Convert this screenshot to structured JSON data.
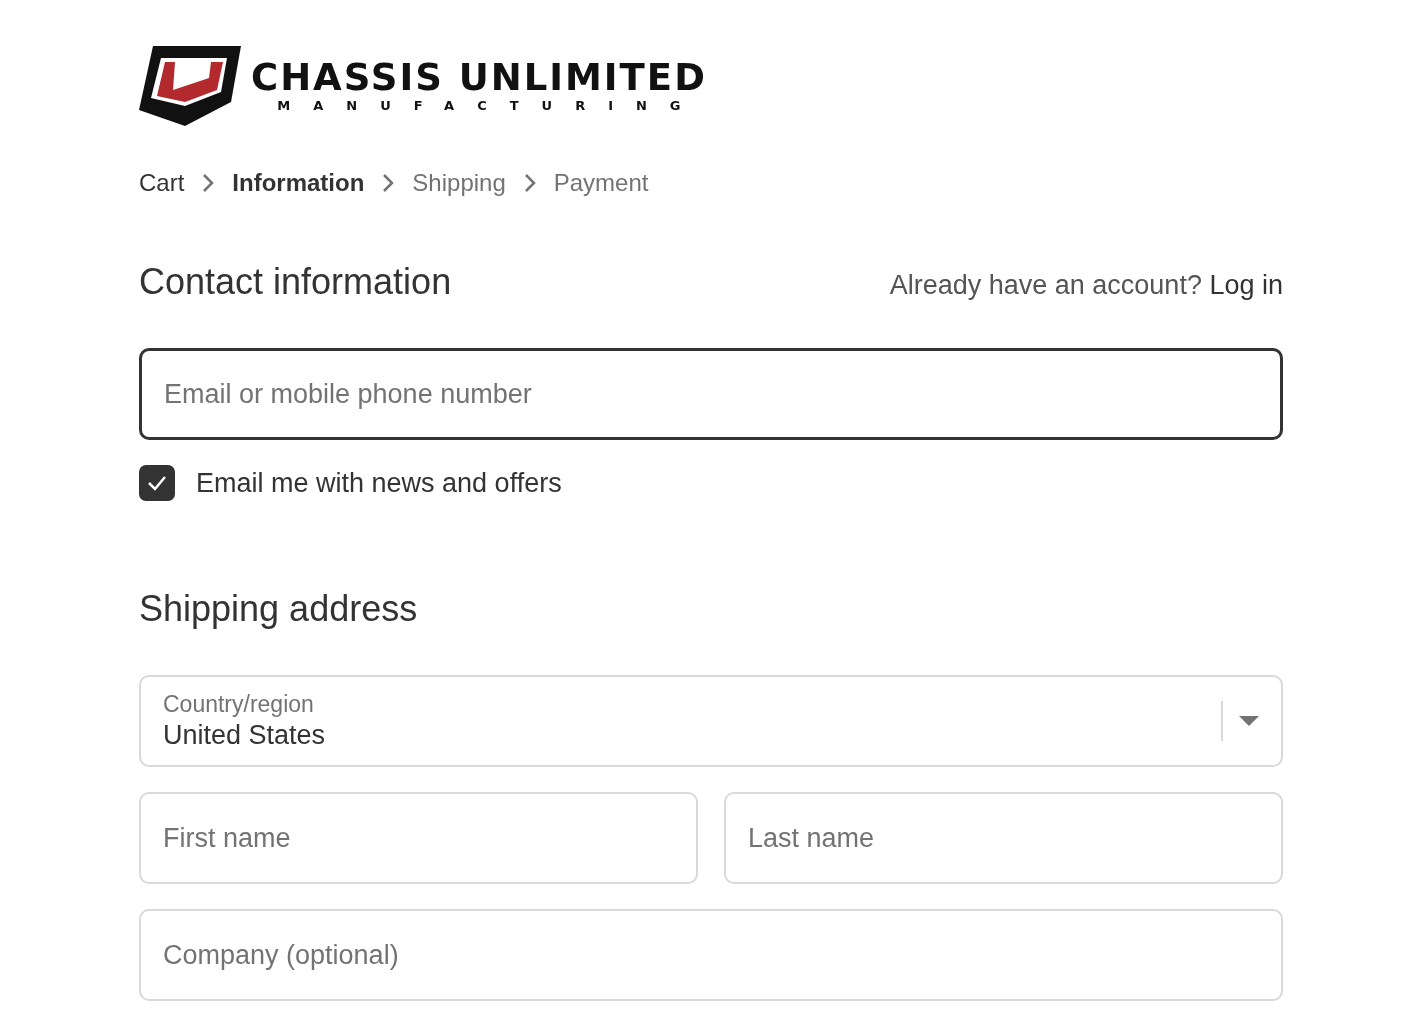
{
  "logo": {
    "name": "CHASSIS UNLIMITED",
    "tagline": "MANUFACTURING"
  },
  "breadcrumbs": [
    {
      "label": "Cart",
      "selected": false,
      "completed": true
    },
    {
      "label": "Information",
      "selected": true,
      "completed": false
    },
    {
      "label": "Shipping",
      "selected": false,
      "completed": false
    },
    {
      "label": "Payment",
      "selected": false,
      "completed": false
    }
  ],
  "contact": {
    "title": "Contact information",
    "login_prompt": "Already have an account?",
    "login_link": "Log in",
    "email_placeholder": "Email or mobile phone number",
    "email_focused": true,
    "newsletter": {
      "label": "Email me with news and offers",
      "checked": true
    }
  },
  "shipping": {
    "title": "Shipping address",
    "country": {
      "label": "Country/region",
      "value": "United States"
    },
    "first_name_placeholder": "First name",
    "last_name_placeholder": "Last name",
    "company_placeholder": "Company (optional)"
  }
}
